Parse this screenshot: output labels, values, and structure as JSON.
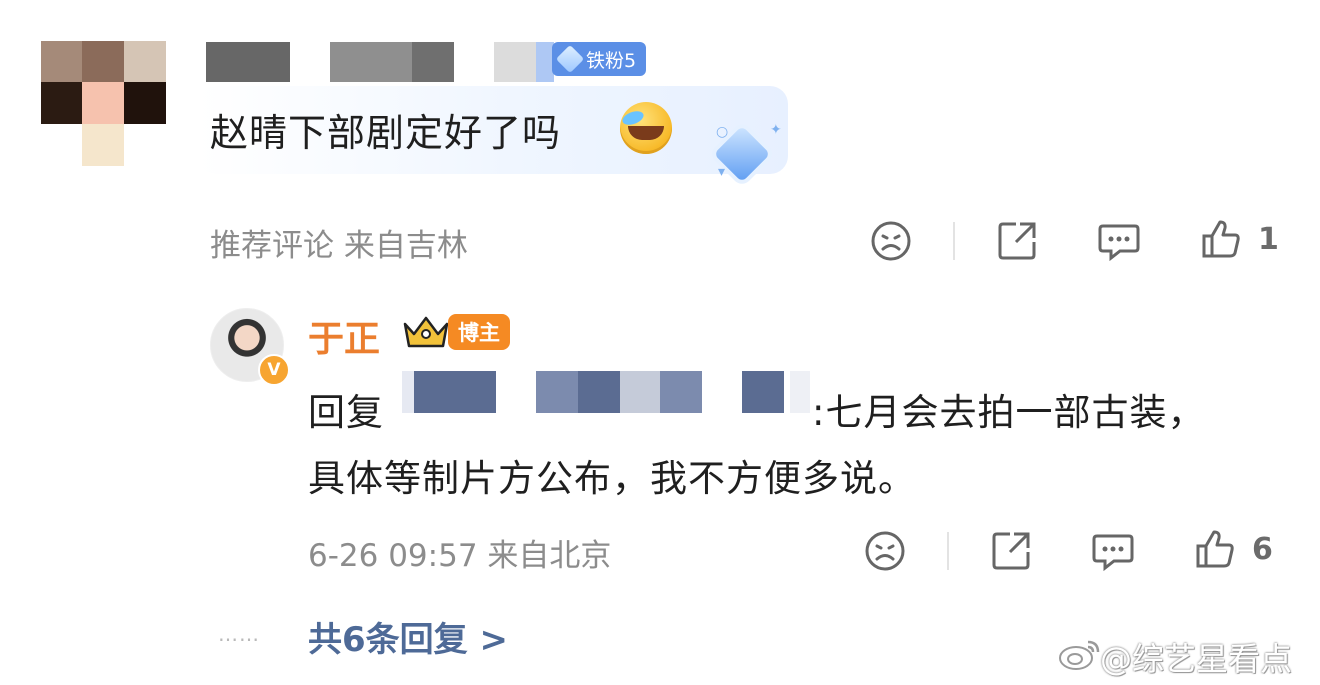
{
  "top_comment": {
    "fan_badge": "铁粉5",
    "text": "赵晴下部剧定好了吗",
    "emoji": "laugh-cry-emoji",
    "meta_text": "推荐评论  来自吉林",
    "like_count": "1"
  },
  "reply": {
    "author_name": "于正",
    "verified_badge": "V",
    "role_tag": "博主",
    "reply_prefix": "回复",
    "reply_text_line1": ":七月会去拍一部古装，",
    "reply_text_line2": "具体等制片方公布，我不方便多说。",
    "meta_text": "6-26 09:57 来自北京",
    "like_count": "6"
  },
  "more_replies": {
    "dots": "……",
    "label": "共6条回复 >"
  },
  "watermark": {
    "text": "@综艺星看点"
  },
  "colors": {
    "accent_orange": "#eb7e2e",
    "link_blue": "#4e6a97",
    "meta_gray": "#8c8c8c",
    "fan_badge_blue": "#5b8fe6"
  }
}
